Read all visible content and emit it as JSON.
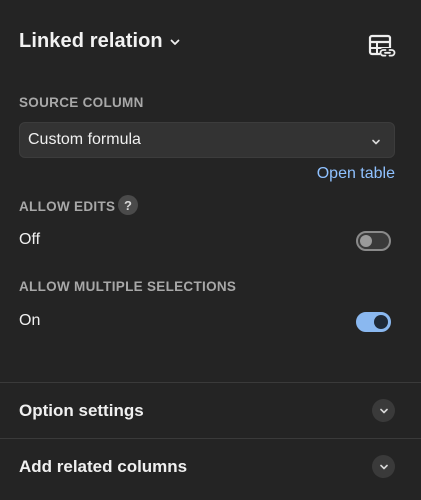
{
  "header": {
    "title": "Linked relation",
    "title_icon": "chevron-down-icon",
    "action_icon": "linked-table-icon"
  },
  "source_column": {
    "label": "SOURCE COLUMN",
    "selected": "Custom formula",
    "open_table_link": "Open table"
  },
  "allow_edits": {
    "label": "ALLOW EDITS",
    "help": "?",
    "value_text": "Off",
    "enabled": false
  },
  "allow_multiple": {
    "label": "ALLOW MULTIPLE SELECTIONS",
    "value_text": "On",
    "enabled": true
  },
  "collapsible_rows": [
    {
      "label": "Option settings"
    },
    {
      "label": "Add related columns"
    }
  ],
  "colors": {
    "background": "#242424",
    "accent": "#8fc1ff",
    "toggle_on": "#8ab8f0"
  }
}
